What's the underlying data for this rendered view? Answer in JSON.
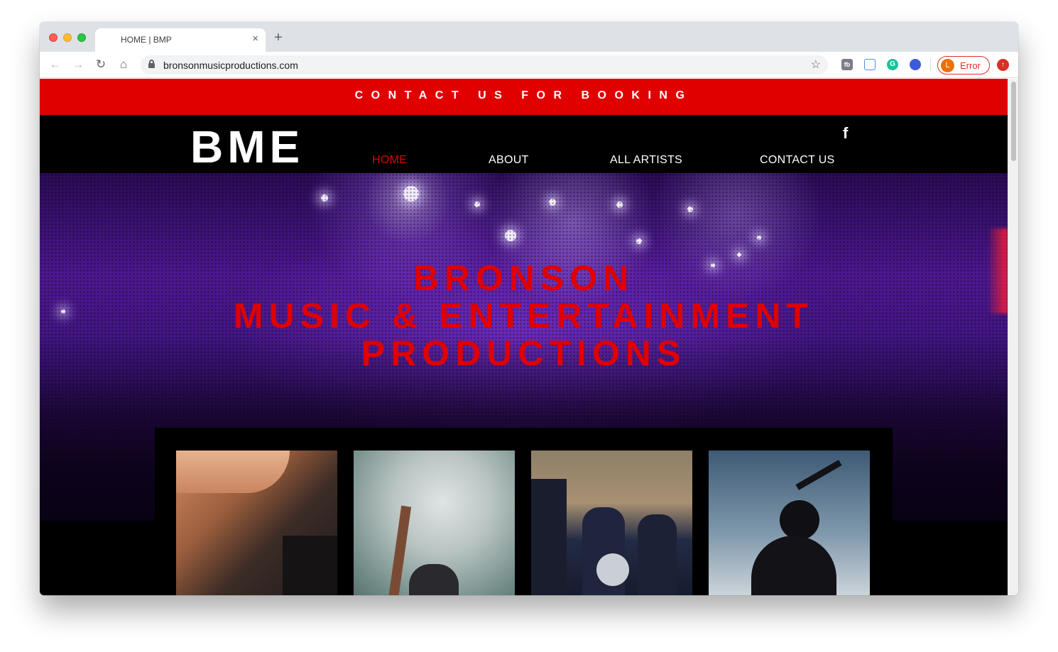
{
  "browser": {
    "tab_title": "HOME | BMP",
    "tab_close_icon": "×",
    "new_tab_icon": "+",
    "url": "bronsonmusicproductions.com",
    "back_icon": "←",
    "forward_icon": "→",
    "reload_icon": "↻",
    "home_icon": "⌂",
    "bookmark_icon": "☆",
    "extensions": [
      "fb-extension-icon",
      "docs-extension-icon",
      "grammarly-icon",
      "vpn-extension-icon"
    ],
    "ext_fb_glyph": "fb",
    "ext_grammarly_glyph": "G",
    "profile_initial": "L",
    "profile_status": "Error",
    "update_glyph": "↑",
    "accent_color": "#d93025"
  },
  "site": {
    "banner_text": "CONTACT US FOR BOOKING",
    "logo": "BME",
    "facebook_icon": "f",
    "nav": [
      {
        "label": "HOME",
        "active": true
      },
      {
        "label": "ABOUT",
        "active": false
      },
      {
        "label": "ALL ARTISTS",
        "active": false
      },
      {
        "label": "CONTACT US",
        "active": false
      }
    ],
    "hero_title": [
      "BRONSON",
      "MUSIC & ENTERTAINMENT",
      "PRODUCTIONS"
    ],
    "brand_red": "#e00000",
    "cards": [
      "dj-mixer-photo",
      "crowd-hand-photo",
      "drummers-photo",
      "dancer-silhouette-photo"
    ]
  }
}
